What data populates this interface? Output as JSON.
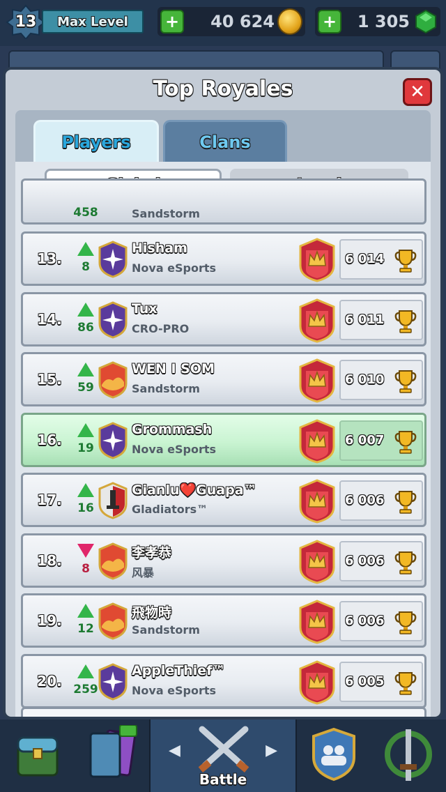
{
  "status_bar": {
    "level": "13",
    "level_label": "Max Level",
    "gold": "40 624",
    "gems": "1 305",
    "gold_plus": "+",
    "gems_plus": "+"
  },
  "popup": {
    "title": "Top Royales",
    "close_label": "✕",
    "tabs": [
      {
        "label": "Players",
        "active": true
      },
      {
        "label": "Clans",
        "active": false
      }
    ],
    "subtabs": [
      {
        "label": "Global",
        "active": true
      },
      {
        "label": "Local",
        "active": false
      }
    ]
  },
  "leaderboard": {
    "partial_top_clan": "Sandstorm",
    "partial_top_delta": "458",
    "rows": [
      {
        "rank": "13.",
        "direction": "up",
        "delta": "8",
        "name": "Hisham",
        "clan": "Nova eSports",
        "trophies": "6 014",
        "badge": "nova",
        "highlight": false
      },
      {
        "rank": "14.",
        "direction": "up",
        "delta": "86",
        "name": "Tux",
        "clan": "CRO-PRO",
        "trophies": "6 011",
        "badge": "nova",
        "highlight": false
      },
      {
        "rank": "15.",
        "direction": "up",
        "delta": "59",
        "name": "WEN I SOM",
        "clan": "Sandstorm",
        "trophies": "6 010",
        "badge": "sandstorm",
        "highlight": false
      },
      {
        "rank": "16.",
        "direction": "up",
        "delta": "19",
        "name": "Grommash",
        "clan": "Nova eSports",
        "trophies": "6 007",
        "badge": "nova",
        "highlight": true
      },
      {
        "rank": "17.",
        "direction": "up",
        "delta": "16",
        "name": "Gianlu❤️Guapa™",
        "clan": "Gladiators™",
        "trophies": "6 006",
        "badge": "gladiators",
        "highlight": false
      },
      {
        "rank": "18.",
        "direction": "down",
        "delta": "8",
        "name": "李孝恭",
        "clan": "风暴",
        "trophies": "6 006",
        "badge": "sandstorm",
        "highlight": false
      },
      {
        "rank": "19.",
        "direction": "up",
        "delta": "12",
        "name": "飛物時",
        "clan": "Sandstorm",
        "trophies": "6 006",
        "badge": "sandstorm",
        "highlight": false
      },
      {
        "rank": "20.",
        "direction": "up",
        "delta": "259",
        "name": "AppleThief™",
        "clan": "Nova eSports",
        "trophies": "6 005",
        "badge": "nova",
        "highlight": false
      }
    ]
  },
  "bottom_nav": {
    "battle_label": "Battle",
    "items": [
      "shop-icon",
      "cards-icon",
      "battle-icon",
      "clan-icon",
      "tournament-icon"
    ]
  },
  "colors": {
    "positive": "#34b54a",
    "negative": "#e0266a",
    "highlight_row": "#c9f4d2",
    "close_button": "#e0383c",
    "active_tab_text": "#2aa7dd"
  }
}
